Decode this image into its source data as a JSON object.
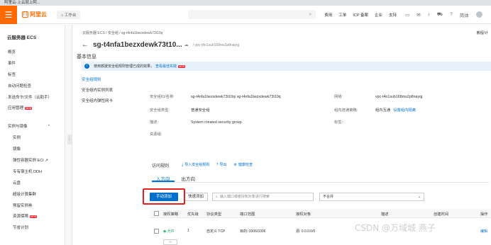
{
  "browser": {
    "tab_title": "阿里云-上云就上阿..."
  },
  "topbar": {
    "logo_text": "阿里云",
    "workbench": "工作台",
    "links": [
      "费用",
      "工单",
      "ICP 备案",
      "企业",
      "支持",
      "简体"
    ]
  },
  "sidebar": {
    "title": "云服务器 ECS",
    "items": [
      {
        "label": "概览"
      },
      {
        "label": "事件"
      },
      {
        "label": "标签"
      },
      {
        "label": "自动问题检查"
      },
      {
        "label": "发送命令/文件（云助手）"
      },
      {
        "label": "应用管理",
        "badge": "NEW"
      }
    ],
    "group": "实例与镜像",
    "subitems": [
      {
        "label": "实例"
      },
      {
        "label": "镜像"
      },
      {
        "label": "弹性容器实例 ECI"
      },
      {
        "label": "专有宿主机 DDH"
      },
      {
        "label": "云盘"
      },
      {
        "label": "超级计算集群"
      },
      {
        "label": "预留实例券"
      },
      {
        "label": "资源保障",
        "badge": "NEW"
      },
      {
        "label": "节省计划"
      }
    ]
  },
  "main": {
    "breadcrumb": "云服务器 ECS  /  安全组  /  sg-t4nfa1bezxdewk73t10q",
    "doc_link": "教程/计",
    "title": "sg-t4nfa1bezxdewk73t10...",
    "subtitle": "/ vpc-t4n1suh168ms2p8nayqj",
    "notice": {
      "text": "使用救援安全组规则管理已成的效果，",
      "link": "查看最佳实践",
      "badge": "NEW"
    },
    "subnav": [
      "安全组规则",
      "安全组内实例列表",
      "安全组内弹性网卡"
    ],
    "basic_info": {
      "title": "基本信息",
      "id_label": "安全组ID/名称:",
      "id_value": "sg-t4nfa1bezxdewk73t10q/ sg-t4nfa1bezxdewk73t10q",
      "type_label": "安全组类型:",
      "type_value": "普通安全组",
      "desc_label": "描述:",
      "desc_value": "System created security group.",
      "rg_label": "资源组:",
      "rg_value": "",
      "net_label": "网络:",
      "net_value": "vpc-t4n1suh168ms2p8nayqj",
      "policy_label": "组内连通策略:",
      "policy_value": "组内互通",
      "policy_link": "设置组内隔离",
      "tag_label": "标签:",
      "tag_value": ""
    },
    "rules": {
      "title": "访问规则",
      "actions": [
        "导入安全组规则",
        "导出",
        "健康检查"
      ],
      "tabs": [
        "入方向",
        "出方向"
      ],
      "add_button": "手动添加",
      "quick_button": "快速添加",
      "search_placeholder": "输入端口或者授权对象进行搜索",
      "select_value": "不合并",
      "columns": [
        "授权策略",
        "优先级",
        "协议类型",
        "端口范围",
        "授权对象",
        "描述",
        "创建时间",
        "操作"
      ],
      "rows": [
        {
          "policy": "允许",
          "priority": "1",
          "protocol": "自定义 TCP",
          "port": "目的: 3306/3306",
          "object": "源: 0.0.0.0/0",
          "op": "编辑"
        }
      ]
    }
  },
  "watermark": "CSDN @万域城 燕子"
}
